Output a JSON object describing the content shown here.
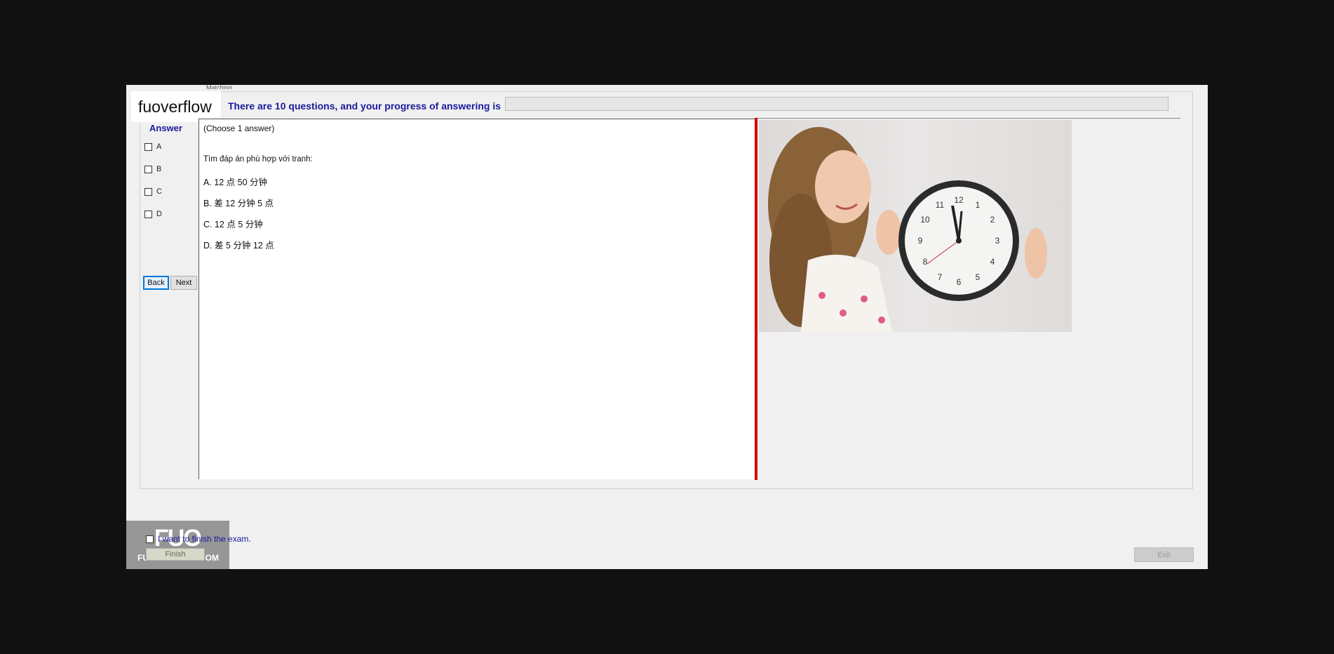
{
  "window": {
    "tab_label": "Matching",
    "brand_top": "fuoverflow",
    "progress_text": "There are 10 questions, and your progress of answering is",
    "progress_fraction": 0
  },
  "answer_panel": {
    "title": "Answer",
    "options": [
      "A",
      "B",
      "C",
      "D"
    ],
    "back_label": "Back",
    "next_label": "Next"
  },
  "question": {
    "hint": "(Choose 1 answer)",
    "prompt": "Tìm đáp án phù hợp với tranh:",
    "options": [
      "A.  12 点 50 分钟",
      "B.  差 12 分钟 5 点",
      "C.  12 点 5 分钟",
      "D.  差 5 分钟 12 点"
    ]
  },
  "footer": {
    "finish_checkbox_label": "I want to finish the exam.",
    "finish_button_label": "Finish",
    "exit_button_label": "Exit",
    "brand_big": "FUO",
    "brand_small": "FUOVERFLOW.COM"
  },
  "colors": {
    "accent_text": "#1a1a9c",
    "splitter": "#d40000",
    "page_background": "#111111"
  }
}
